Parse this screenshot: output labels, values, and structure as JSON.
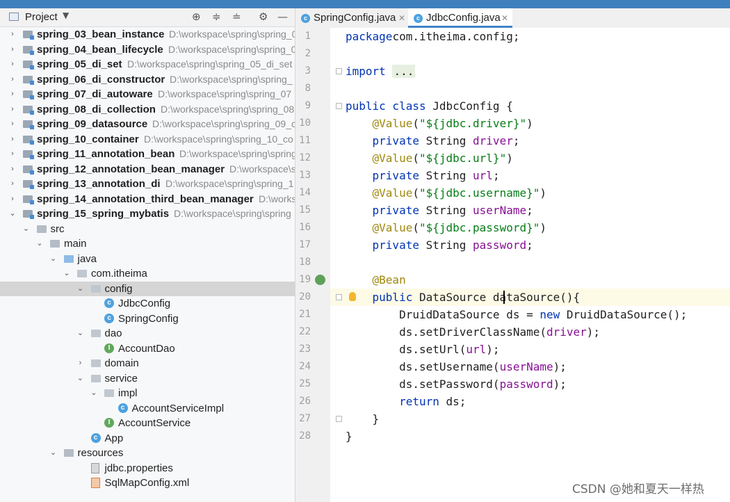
{
  "project_panel": {
    "title": "Project",
    "toolbar_icons": [
      "target-icon",
      "expand-all-icon",
      "collapse-all-icon",
      "gear-icon",
      "minimize-icon"
    ]
  },
  "tree": [
    {
      "label": "spring_03_bean_instance",
      "path": "D:\\workspace\\spring\\spring_0",
      "indent": 0,
      "expand": "collapsed",
      "icon": "module",
      "bold": true
    },
    {
      "label": "spring_04_bean_lifecycle",
      "path": "D:\\workspace\\spring\\spring_0",
      "indent": 0,
      "expand": "collapsed",
      "icon": "module",
      "bold": true
    },
    {
      "label": "spring_05_di_set",
      "path": "D:\\workspace\\spring\\spring_05_di_set",
      "indent": 0,
      "expand": "collapsed",
      "icon": "module",
      "bold": true
    },
    {
      "label": "spring_06_di_constructor",
      "path": "D:\\workspace\\spring\\spring_",
      "indent": 0,
      "expand": "collapsed",
      "icon": "module",
      "bold": true
    },
    {
      "label": "spring_07_di_autoware",
      "path": "D:\\workspace\\spring\\spring_07",
      "indent": 0,
      "expand": "collapsed",
      "icon": "module",
      "bold": true
    },
    {
      "label": "spring_08_di_collection",
      "path": "D:\\workspace\\spring\\spring_08",
      "indent": 0,
      "expand": "collapsed",
      "icon": "module",
      "bold": true
    },
    {
      "label": "spring_09_datasource",
      "path": "D:\\workspace\\spring\\spring_09_c",
      "indent": 0,
      "expand": "collapsed",
      "icon": "module",
      "bold": true
    },
    {
      "label": "spring_10_container",
      "path": "D:\\workspace\\spring\\spring_10_co",
      "indent": 0,
      "expand": "collapsed",
      "icon": "module",
      "bold": true
    },
    {
      "label": "spring_11_annotation_bean",
      "path": "D:\\workspace\\spring\\spring",
      "indent": 0,
      "expand": "collapsed",
      "icon": "module",
      "bold": true
    },
    {
      "label": "spring_12_annotation_bean_manager",
      "path": "D:\\workspace\\sp",
      "indent": 0,
      "expand": "collapsed",
      "icon": "module",
      "bold": true
    },
    {
      "label": "spring_13_annotation_di",
      "path": "D:\\workspace\\spring\\spring_1",
      "indent": 0,
      "expand": "collapsed",
      "icon": "module",
      "bold": true
    },
    {
      "label": "spring_14_annotation_third_bean_manager",
      "path": "D:\\worksp",
      "indent": 0,
      "expand": "collapsed",
      "icon": "module",
      "bold": true
    },
    {
      "label": "spring_15_spring_mybatis",
      "path": "D:\\workspace\\spring\\spring",
      "indent": 0,
      "expand": "expanded",
      "icon": "module",
      "bold": true
    },
    {
      "label": "src",
      "indent": 1,
      "expand": "expanded",
      "icon": "folder"
    },
    {
      "label": "main",
      "indent": 2,
      "expand": "expanded",
      "icon": "folder"
    },
    {
      "label": "java",
      "indent": 3,
      "expand": "expanded",
      "icon": "folder-blue"
    },
    {
      "label": "com.itheima",
      "indent": 4,
      "expand": "expanded",
      "icon": "package"
    },
    {
      "label": "config",
      "indent": 5,
      "expand": "expanded",
      "icon": "package",
      "selected": true
    },
    {
      "label": "JdbcConfig",
      "indent": 6,
      "expand": "none",
      "icon": "class"
    },
    {
      "label": "SpringConfig",
      "indent": 6,
      "expand": "none",
      "icon": "class"
    },
    {
      "label": "dao",
      "indent": 5,
      "expand": "expanded",
      "icon": "package"
    },
    {
      "label": "AccountDao",
      "indent": 6,
      "expand": "none",
      "icon": "interface"
    },
    {
      "label": "domain",
      "indent": 5,
      "expand": "collapsed",
      "icon": "package"
    },
    {
      "label": "service",
      "indent": 5,
      "expand": "expanded",
      "icon": "package"
    },
    {
      "label": "impl",
      "indent": 6,
      "expand": "expanded",
      "icon": "package"
    },
    {
      "label": "AccountServiceImpl",
      "indent": 7,
      "expand": "none",
      "icon": "class"
    },
    {
      "label": "AccountService",
      "indent": 6,
      "expand": "none",
      "icon": "interface"
    },
    {
      "label": "App",
      "indent": 5,
      "expand": "none",
      "icon": "app"
    },
    {
      "label": "resources",
      "indent": 3,
      "expand": "expanded",
      "icon": "folder-res"
    },
    {
      "label": "jdbc.properties",
      "indent": 5,
      "expand": "none",
      "icon": "properties"
    },
    {
      "label": "SqlMapConfig.xml",
      "indent": 5,
      "expand": "none",
      "icon": "xml"
    }
  ],
  "tabs": [
    {
      "label": "SpringConfig.java",
      "active": false
    },
    {
      "label": "JdbcConfig.java",
      "active": true
    }
  ],
  "code_lines": [
    {
      "n": "1",
      "tokens": [
        [
          "kw",
          "package"
        ],
        [
          "",
          "com.itheima.config;"
        ]
      ]
    },
    {
      "n": "2",
      "tokens": []
    },
    {
      "n": "3",
      "tokens": [
        [
          "kw",
          "import "
        ],
        [
          "fold",
          "..."
        ]
      ]
    },
    {
      "n": "8",
      "tokens": []
    },
    {
      "n": "9",
      "tokens": [
        [
          "kw",
          "public class"
        ],
        [
          "",
          " JdbcConfig {"
        ]
      ]
    },
    {
      "n": "10",
      "tokens": [
        [
          "",
          "    "
        ],
        [
          "ann",
          "@Value"
        ],
        [
          "",
          "("
        ],
        [
          "str",
          "\"${jdbc.driver}\""
        ],
        [
          "",
          ")"
        ]
      ]
    },
    {
      "n": "11",
      "tokens": [
        [
          "",
          "    "
        ],
        [
          "kw",
          "private"
        ],
        [
          "",
          " String "
        ],
        [
          "fld",
          "driver"
        ],
        [
          "",
          ";"
        ]
      ]
    },
    {
      "n": "12",
      "tokens": [
        [
          "",
          "    "
        ],
        [
          "ann",
          "@Value"
        ],
        [
          "",
          "("
        ],
        [
          "str",
          "\"${jdbc.url}\""
        ],
        [
          "",
          ")"
        ]
      ]
    },
    {
      "n": "13",
      "tokens": [
        [
          "",
          "    "
        ],
        [
          "kw",
          "private"
        ],
        [
          "",
          " String "
        ],
        [
          "fld",
          "url"
        ],
        [
          "",
          ";"
        ]
      ]
    },
    {
      "n": "14",
      "tokens": [
        [
          "",
          "    "
        ],
        [
          "ann",
          "@Value"
        ],
        [
          "",
          "("
        ],
        [
          "str",
          "\"${jdbc.username}\""
        ],
        [
          "",
          ")"
        ]
      ]
    },
    {
      "n": "15",
      "tokens": [
        [
          "",
          "    "
        ],
        [
          "kw",
          "private"
        ],
        [
          "",
          " String "
        ],
        [
          "fld",
          "userName"
        ],
        [
          "",
          ";"
        ]
      ]
    },
    {
      "n": "16",
      "tokens": [
        [
          "",
          "    "
        ],
        [
          "ann",
          "@Value"
        ],
        [
          "",
          "("
        ],
        [
          "str",
          "\"${jdbc.password}\""
        ],
        [
          "",
          ")"
        ]
      ]
    },
    {
      "n": "17",
      "tokens": [
        [
          "",
          "    "
        ],
        [
          "kw",
          "private"
        ],
        [
          "",
          " String "
        ],
        [
          "fld",
          "password"
        ],
        [
          "",
          ";"
        ]
      ]
    },
    {
      "n": "18",
      "tokens": []
    },
    {
      "n": "19",
      "tokens": [
        [
          "",
          "    "
        ],
        [
          "ann",
          "@Bean"
        ]
      ]
    },
    {
      "n": "20",
      "tokens": [
        [
          "",
          "    "
        ],
        [
          "kw",
          "public"
        ],
        [
          "",
          " DataSource "
        ],
        [
          "",
          "dataSource"
        ],
        [
          "",
          "(){"
        ]
      ]
    },
    {
      "n": "21",
      "tokens": [
        [
          "",
          "        DruidDataSource ds = "
        ],
        [
          "kw",
          "new"
        ],
        [
          "",
          " DruidDataSource();"
        ]
      ]
    },
    {
      "n": "22",
      "tokens": [
        [
          "",
          "        ds.setDriverClassName("
        ],
        [
          "fld",
          "driver"
        ],
        [
          "",
          ");"
        ]
      ]
    },
    {
      "n": "23",
      "tokens": [
        [
          "",
          "        ds.setUrl("
        ],
        [
          "fld",
          "url"
        ],
        [
          "",
          ");"
        ]
      ]
    },
    {
      "n": "24",
      "tokens": [
        [
          "",
          "        ds.setUsername("
        ],
        [
          "fld",
          "userName"
        ],
        [
          "",
          ");"
        ]
      ]
    },
    {
      "n": "25",
      "tokens": [
        [
          "",
          "        ds.setPassword("
        ],
        [
          "fld",
          "password"
        ],
        [
          "",
          ");"
        ]
      ]
    },
    {
      "n": "26",
      "tokens": [
        [
          "",
          "        "
        ],
        [
          "kw",
          "return"
        ],
        [
          "",
          " ds;"
        ]
      ]
    },
    {
      "n": "27",
      "tokens": [
        [
          "",
          "    }"
        ]
      ]
    },
    {
      "n": "28",
      "tokens": [
        [
          "",
          "}"
        ]
      ]
    }
  ],
  "watermark": "CSDN @她和夏天一样热"
}
